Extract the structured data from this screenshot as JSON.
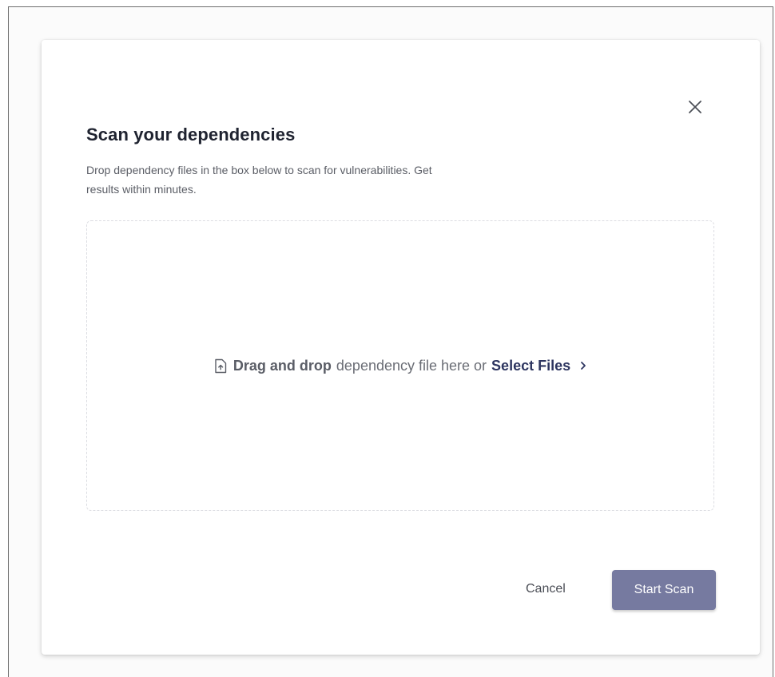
{
  "dialog": {
    "title": "Scan your dependencies",
    "description": "Drop dependency files in the box below to scan for vulnerabilities. Get results within minutes.",
    "close_icon": "close-icon"
  },
  "dropzone": {
    "icon": "file-upload-icon",
    "drag_bold": "Drag and drop",
    "drag_rest": "dependency file here or",
    "select_label": "Select Files",
    "select_icon": "chevron-right-icon"
  },
  "footer": {
    "cancel_label": "Cancel",
    "start_label": "Start Scan"
  },
  "colors": {
    "primary_button": "#767aa0",
    "link": "#2d3560",
    "title": "#1f2330"
  }
}
